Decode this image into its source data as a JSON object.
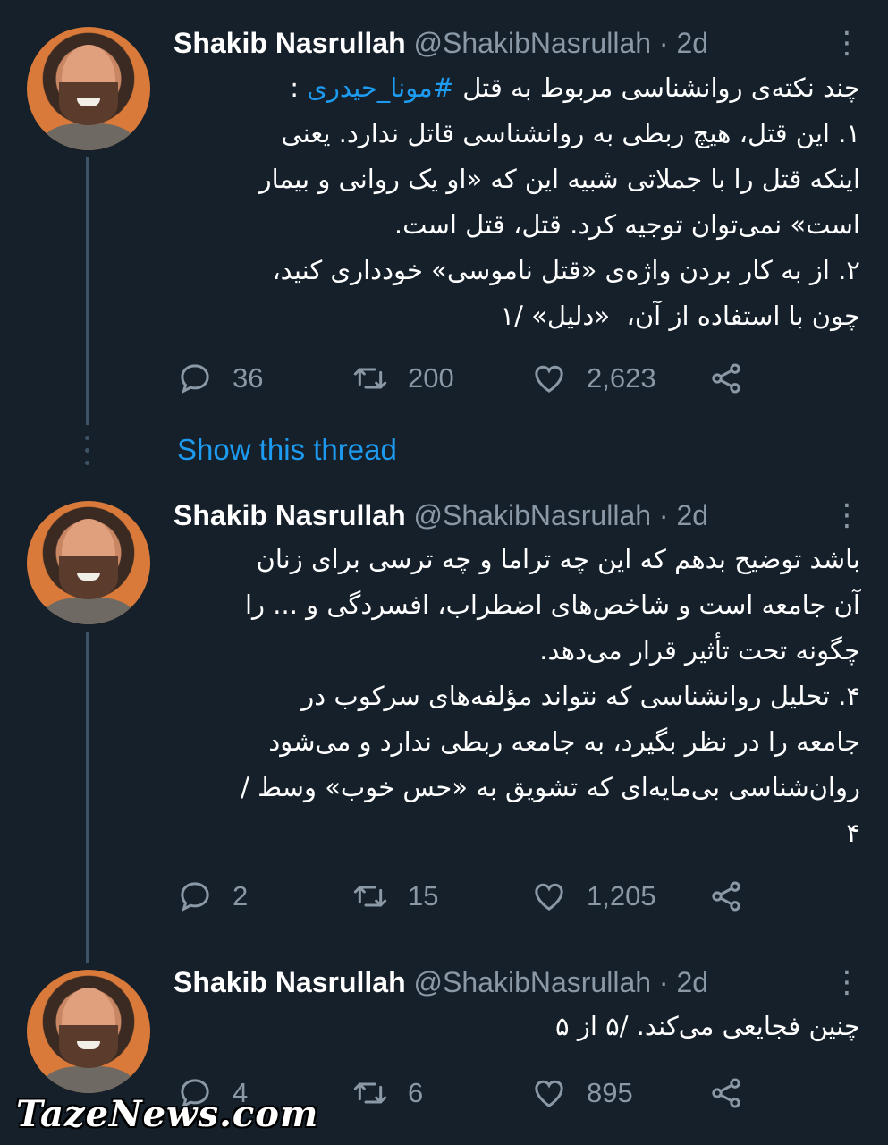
{
  "tweets": [
    {
      "name": "Shakib Nasrullah",
      "handle": "@ShakibNasrullah",
      "separator": " · ",
      "time": "2d",
      "text_lines": [
        "چند نکته‌ی روانشناسی مربوط به قتل ",
        "۱. این قتل، هیچ ربطی به روانشناسی قاتل ندارد. یعنی",
        "اینکه قتل را با جملاتی شبیه این که «او یک روانی و بیمار",
        "است» نمی‌توان توجیه کرد. قتل، قتل است.",
        "۲. از به کار بردن واژه‌ی «قتل ناموسی» خودداری کنید،",
        "چون با استفاده از آن،  «دلیل» /۱"
      ],
      "hashtag": "#مونا_حیدری",
      "hashtag_suffix": " :",
      "replies": "36",
      "retweets": "200",
      "likes": "2,623"
    },
    {
      "name": "Shakib Nasrullah",
      "handle": "@ShakibNasrullah",
      "separator": " · ",
      "time": "2d",
      "text_lines": [
        "باشد توضیح بدهم که این چه تراما و چه ترسی برای زنان",
        "آن جامعه است و شاخص‌های اضطراب، افسردگی و ... را",
        "چگونه تحت تأثیر قرار می‌دهد.",
        "۴. تحلیل روانشناسی که نتواند مؤلفه‌های سرکوب در",
        "جامعه را در نظر بگیرد، به جامعه ربطی ندارد و می‌شود",
        "روان‌شناسی بی‌مایه‌ای که تشویق به «حس خوب» وسط /",
        "۴"
      ],
      "replies": "2",
      "retweets": "15",
      "likes": "1,205"
    },
    {
      "name": "Shakib Nasrullah",
      "handle": "@ShakibNasrullah",
      "separator": " · ",
      "time": "2d",
      "text_lines": [
        "چنین فجایعی می‌کند. /۵ از ۵"
      ],
      "replies": "4",
      "retweets": "6",
      "likes": "895"
    }
  ],
  "show_thread": "Show this thread",
  "watermark": "TazeNews.com",
  "icons": {
    "more": "more-vertical-icon",
    "reply": "reply-bubble-icon",
    "retweet": "retweet-arrows-icon",
    "like": "heart-icon",
    "share": "share-nodes-icon"
  },
  "colors": {
    "background": "#15202b",
    "link": "#1d9bf0",
    "muted": "#8b98a5",
    "thread_line": "#3d5466"
  }
}
